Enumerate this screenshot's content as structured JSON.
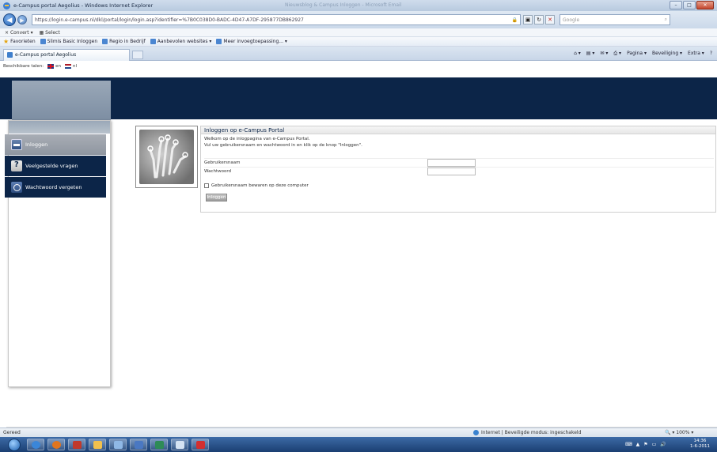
{
  "window": {
    "title": "e-Campus portal Aegolius - Windows Internet Explorer",
    "ghost_title": "Nieuwsblog & Campus Inloggen - Microsoft Email",
    "buttons": {
      "minimize": "–",
      "maximize": "□",
      "close": "✕"
    }
  },
  "address": {
    "url": "https://login.e-campus.nl/dkl/portal/login/login.asp?identifier=%7B0C038D0-BADC-4D47-A7DF-295877DB862927",
    "search_placeholder": "Google",
    "lock_label": "🔒"
  },
  "commands": {
    "convert": "Convert",
    "select": "Select"
  },
  "favorites": {
    "label": "Favorieten",
    "items": [
      "Slimis Basic Inloggen",
      "Regio in Bedrijf",
      "Aanbevolen websites ▾",
      "Meer invoegtoepassing... ▾"
    ]
  },
  "tab": {
    "label": "e-Campus portal Aegolius"
  },
  "toolbar_cmds": [
    "Pagina ▾",
    "Beveiliging ▾",
    "Extra ▾",
    "?"
  ],
  "language": {
    "label": "Beschikbare talen:",
    "en": "en",
    "nl": "nl"
  },
  "sidebar": {
    "items": [
      {
        "label": "Inloggen"
      },
      {
        "label": "Veelgestelde vragen"
      },
      {
        "label": "Wachtwoord vergeten"
      }
    ]
  },
  "login": {
    "title": "Inloggen op e-Campus Portal",
    "intro1": "Welkom op de inlogpagina van e-Campus Portal.",
    "intro2": "Vul uw gebruikersnaam en wachtwoord in en klik op de knop \"Inloggen\".",
    "username_label": "Gebruikersnaam",
    "password_label": "Wachtwoord",
    "remember_label": "Gebruikersnaam bewaren op deze computer",
    "button_label": "Inloggen"
  },
  "status": {
    "left": "Gereed",
    "zone": "Internet | Beveiligde modus: ingeschakeld",
    "zoom": "100%"
  },
  "taskbar": {
    "time": "14:36",
    "date": "1-6-2011"
  },
  "colors": {
    "header_navy": "#0c2548",
    "accent_grey": "#9aa8b8"
  }
}
